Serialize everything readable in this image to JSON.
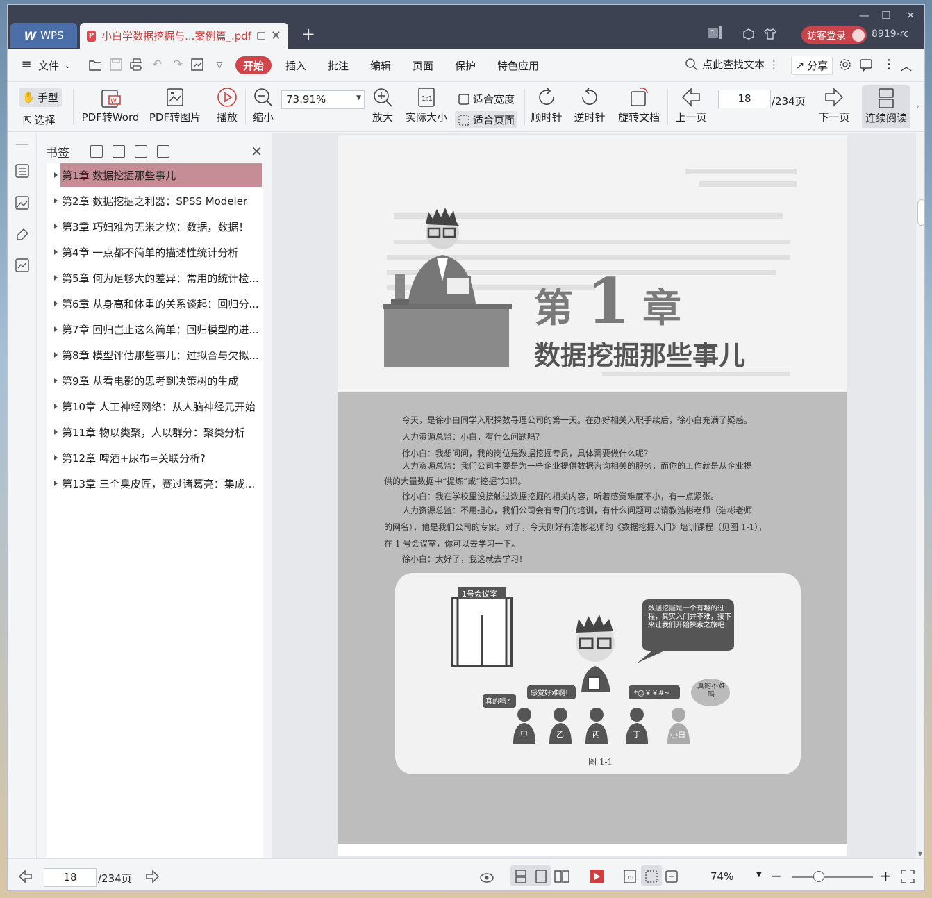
{
  "tabs": {
    "home_label": "WPS",
    "doc_title": "小白学数据挖掘与...案例篇_.pdf"
  },
  "titlebar": {
    "page_badge": "1",
    "login_label": "访客登录",
    "version": "8919-rc"
  },
  "menu": {
    "file_label": "文件",
    "start_label": "开始",
    "items": [
      "插入",
      "批注",
      "编辑",
      "页面",
      "保护",
      "特色应用"
    ],
    "search_label": "点此查找文本",
    "share_label": "分享"
  },
  "toolbar": {
    "hand_label": "手型",
    "select_label": "选择",
    "pdf_to_word": "PDF转Word",
    "pdf_to_image": "PDF转图片",
    "play": "播放",
    "zoom_out": "缩小",
    "zoom_value": "73.91%",
    "zoom_in": "放大",
    "actual_size": "实际大小",
    "fit_width": "适合宽度",
    "fit_page": "适合页面",
    "clockwise": "顺时针",
    "counter_clockwise": "逆时针",
    "rotate_doc": "旋转文档",
    "prev_page": "上一页",
    "current_page": "18",
    "total_pages": "/234页",
    "next_page": "下一页",
    "continuous_read": "连续阅读"
  },
  "bookmarks": {
    "title": "书签",
    "items": [
      "第1章 数据挖掘那些事儿",
      "第2章 数据挖掘之利器：SPSS Modeler",
      "第3章 巧妇难为无米之炊：数据，数据！",
      "第4章 一点都不简单的描述性统计分析",
      "第5章 何为足够大的差异：常用的统计检...",
      "第6章 从身高和体重的关系谈起：回归分...",
      "第7章 回归岂止这么简单：回归模型的进...",
      "第8章 模型评估那些事儿：过拟合与欠拟...",
      "第9章 从看电影的思考到决策树的生成",
      "第10章 人工神经网络：从人脑神经元开始",
      "第11章 物以类聚，人以群分：聚类分析",
      "第12章 啤酒+尿布=关联分析?",
      "第13章 三个臭皮匠，赛过诸葛亮：集成..."
    ]
  },
  "page_content": {
    "chapter_prefix": "第",
    "chapter_num": "1",
    "chapter_suffix": "章",
    "chapter_title": "数据挖掘那些事儿",
    "paragraphs": [
      "今天，是徐小白同学入职探数寻理公司的第一天。在办好相关入职手续后，徐小白充满了疑惑。",
      "人力资源总监：小白，有什么问题吗？",
      "徐小白：我想问问，我的岗位是数据挖掘专员，具体需要做什么呢？",
      "人力资源总监：我们公司主要是为一些企业提供数据咨询相关的服务，而你的工作就是从企业提",
      "供的大量数据中“提炼”或“挖掘”知识。",
      "徐小白：我在学校里没接触过数据挖掘的相关内容，听着感觉难度不小，有一点紧张。",
      "人力资源总监：不用担心，我们公司会有专门的培训，有什么问题可以请教浩彬老师（浩彬老师",
      "的网名），他是我们公司的专家。对了，今天刚好有浩彬老师的《数据挖掘入门》培训课程（见图 1-1），",
      "在 1 号会议室，你可以去学习一下。",
      "徐小白：太好了，我这就去学习！"
    ],
    "figure": {
      "room_label": "1号会议室",
      "speech_bubble": "数据挖掘是一个有趣的过程，其实入门并不难，接下来让我们开始探索之旅吧",
      "b1": "真的吗?",
      "b2": "感觉好难啊!",
      "b3": "*@￥￥#~",
      "thought": "真的不难吗",
      "people": [
        "甲",
        "乙",
        "丙",
        "丁",
        "小白"
      ],
      "caption": "图 1-1"
    }
  },
  "statusbar": {
    "current_page": "18",
    "total_pages": "/234页",
    "zoom_pct": "74%"
  }
}
